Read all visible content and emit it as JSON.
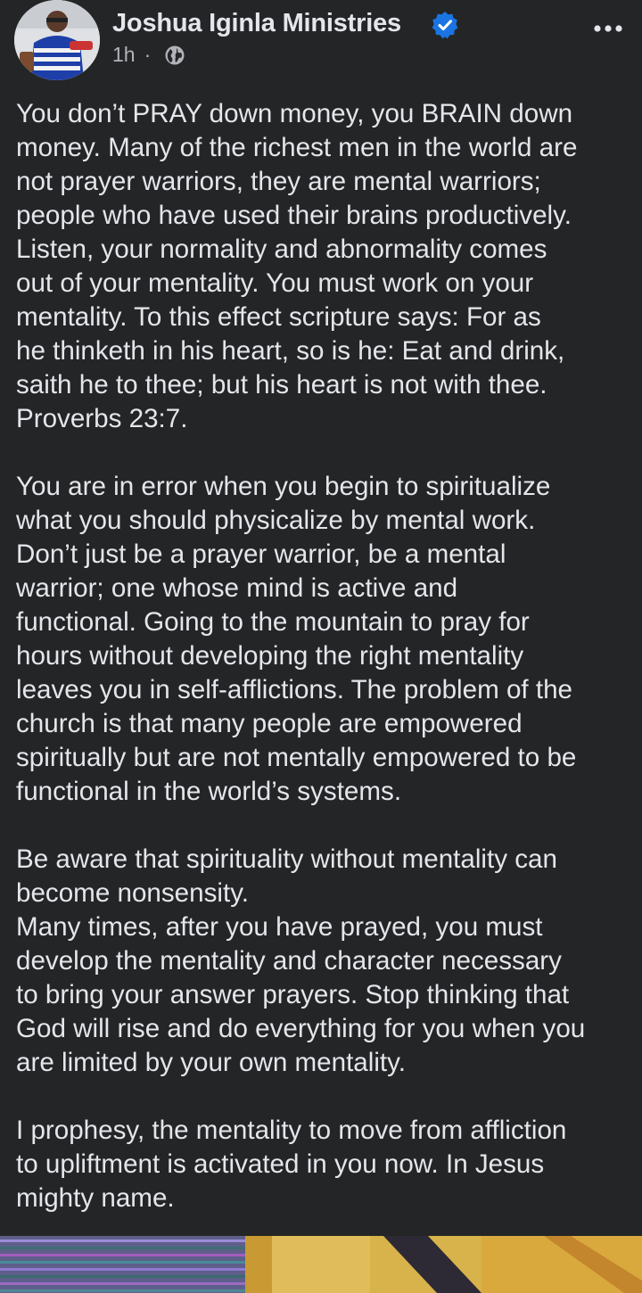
{
  "post": {
    "author": "Joshua Iginla Ministries",
    "timestamp": "1h",
    "separator": "·",
    "audience_icon": "globe-icon",
    "verified_icon": "verified-badge-icon",
    "more_icon": "more-horizontal-icon",
    "paragraphs": [
      "You don’t PRAY down money, you BRAIN down\nmoney. Many of the richest men in the world are\nnot prayer warriors, they are mental warriors;\npeople who have used their brains productively.\nListen, your normality and abnormality comes\nout of your mentality. You must work on your\nmentality. To this effect scripture says: For as\nhe thinketh in his heart, so is he: Eat and drink,\nsaith he to thee; but his heart is not with thee.\nProverbs 23:7.",
      "You are in error when you begin to spiritualize\nwhat you should physicalize by mental work.\nDon’t just be a prayer warrior, be a mental\nwarrior; one whose mind is active and\nfunctional. Going to the mountain to pray for\nhours without developing the right mentality\nleaves you in self-afflictions. The problem of the\nchurch is that many people are empowered\nspiritually but are not mentally empowered to be\nfunctional in the world’s systems.",
      "Be aware that spirituality without mentality can\nbecome nonsensity.\nMany times, after you have prayed, you must\ndevelop the mentality and character necessary\nto bring your answer prayers. Stop thinking that\nGod will rise and do everything for you when you\nare limited by your own mentality.",
      "I prophesy, the mentality to move from affliction\nto upliftment is activated in you now. In Jesus\nmighty name."
    ]
  },
  "colors": {
    "background": "#242526",
    "text_primary": "#e4e6eb",
    "text_secondary": "#b0b3b8",
    "verified_blue": "#1b74e4"
  }
}
